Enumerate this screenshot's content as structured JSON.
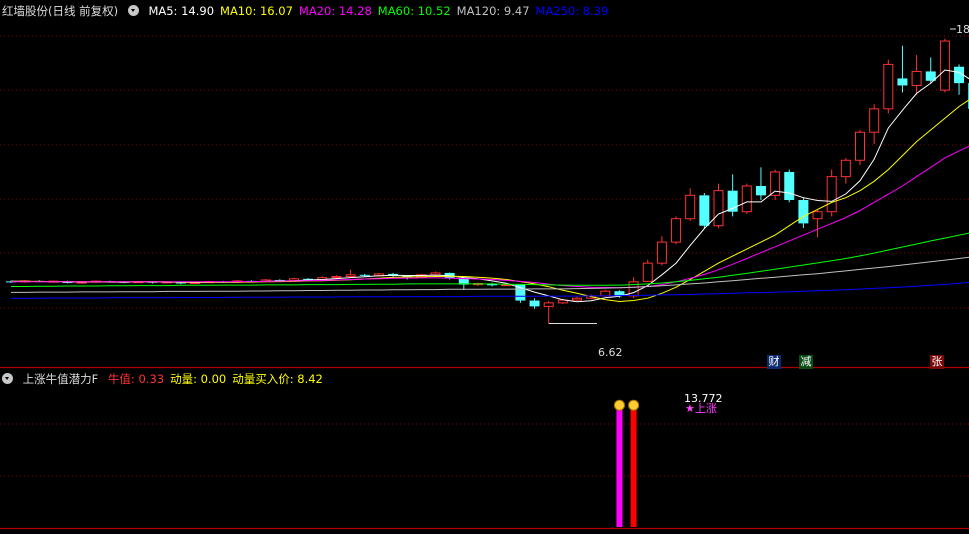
{
  "header": {
    "stock": "红墙股份(日线 前复权)",
    "ma": [
      {
        "label": "MA5: 14.90",
        "color": "#ffffff"
      },
      {
        "label": "MA10: 16.07",
        "color": "#ffff00"
      },
      {
        "label": "MA20: 14.28",
        "color": "#ff00ff"
      },
      {
        "label": "MA60: 10.52",
        "color": "#00ff00"
      },
      {
        "label": "MA120: 9.47",
        "color": "#c0c0c0"
      },
      {
        "label": "MA250: 8.39",
        "color": "#0000ff"
      }
    ]
  },
  "indicator": {
    "name": "上涨牛值潜力F",
    "items": [
      {
        "label": "牛值: 0.33",
        "color": "#ff3333"
      },
      {
        "label": "动量: 0.00",
        "color": "#ffff00"
      },
      {
        "label": "动量买入价: 8.42",
        "color": "#ffff00"
      }
    ]
  },
  "colors": {
    "up": "#ff3232",
    "down": "#54ffff",
    "grid": "#8b0000"
  },
  "annotations": {
    "low_price": "6.62",
    "high_price": "18.",
    "signal_value": "13.772",
    "signal_text": "★上涨",
    "tag_cai": "财",
    "tag_jian": "减",
    "tag_zhang": "张"
  },
  "chart_data": [
    {
      "type": "candlestick",
      "title": "红墙股份(日线 前复权)",
      "ylim": [
        4.8,
        19.6
      ],
      "candles": [
        [
          8.42,
          8.38,
          8.45,
          8.35
        ],
        [
          8.4,
          8.44,
          8.48,
          8.36
        ],
        [
          8.44,
          8.41,
          8.47,
          8.38
        ],
        [
          8.41,
          8.43,
          8.46,
          8.37
        ],
        [
          8.43,
          8.35,
          8.45,
          8.33
        ],
        [
          8.35,
          8.39,
          8.42,
          8.33
        ],
        [
          8.39,
          8.43,
          8.46,
          8.36
        ],
        [
          8.43,
          8.4,
          8.45,
          8.37
        ],
        [
          8.4,
          8.37,
          8.43,
          8.34
        ],
        [
          8.37,
          8.41,
          8.44,
          8.35
        ],
        [
          8.41,
          8.36,
          8.43,
          8.33
        ],
        [
          8.36,
          8.4,
          8.42,
          8.34
        ],
        [
          8.4,
          8.33,
          8.42,
          8.3
        ],
        [
          8.33,
          8.37,
          8.4,
          8.31
        ],
        [
          8.37,
          8.41,
          8.44,
          8.35
        ],
        [
          8.41,
          8.38,
          8.44,
          8.36
        ],
        [
          8.38,
          8.44,
          8.48,
          8.36
        ],
        [
          8.44,
          8.41,
          8.47,
          8.39
        ],
        [
          8.41,
          8.48,
          8.52,
          8.4
        ],
        [
          8.48,
          8.45,
          8.51,
          8.43
        ],
        [
          8.45,
          8.53,
          8.58,
          8.44
        ],
        [
          8.53,
          8.5,
          8.56,
          8.47
        ],
        [
          8.5,
          8.58,
          8.64,
          8.48
        ],
        [
          8.58,
          8.63,
          8.68,
          8.55
        ],
        [
          8.63,
          8.7,
          8.92,
          8.6
        ],
        [
          8.7,
          8.66,
          8.74,
          8.62
        ],
        [
          8.66,
          8.74,
          8.78,
          8.64
        ],
        [
          8.74,
          8.65,
          8.78,
          8.61
        ],
        [
          8.65,
          8.6,
          8.68,
          8.5
        ],
        [
          8.6,
          8.7,
          8.74,
          8.58
        ],
        [
          8.7,
          8.78,
          8.84,
          8.66
        ],
        [
          8.78,
          8.55,
          8.8,
          8.5
        ],
        [
          8.55,
          8.28,
          8.58,
          8.05
        ],
        [
          8.28,
          8.33,
          8.37,
          8.22
        ],
        [
          8.33,
          8.25,
          8.36,
          8.2
        ],
        [
          8.25,
          8.28,
          8.31,
          8.22
        ],
        [
          8.28,
          7.6,
          8.3,
          7.5
        ],
        [
          7.6,
          7.35,
          7.7,
          7.25
        ],
        [
          7.35,
          7.5,
          7.58,
          6.62
        ],
        [
          7.5,
          7.62,
          7.68,
          7.45
        ],
        [
          7.62,
          7.7,
          7.76,
          7.58
        ],
        [
          7.7,
          7.8,
          7.86,
          7.66
        ],
        [
          7.8,
          8.0,
          8.06,
          7.76
        ],
        [
          8.0,
          7.8,
          8.04,
          7.72
        ],
        [
          7.8,
          8.4,
          8.6,
          7.7
        ],
        [
          8.42,
          9.2,
          9.35,
          8.4
        ],
        [
          9.2,
          10.1,
          10.35,
          9.1
        ],
        [
          10.1,
          11.1,
          11.2,
          10.0
        ],
        [
          11.1,
          12.1,
          12.4,
          11.0
        ],
        [
          12.1,
          10.8,
          12.2,
          10.7
        ],
        [
          10.8,
          12.3,
          12.6,
          10.7
        ],
        [
          12.3,
          11.4,
          13.0,
          11.2
        ],
        [
          11.4,
          12.5,
          12.6,
          11.3
        ],
        [
          12.5,
          12.1,
          13.3,
          11.9
        ],
        [
          12.1,
          13.1,
          13.2,
          11.9
        ],
        [
          13.1,
          11.9,
          13.2,
          11.8
        ],
        [
          11.9,
          10.9,
          12.0,
          10.7
        ],
        [
          11.1,
          11.4,
          11.5,
          10.3
        ],
        [
          11.4,
          12.9,
          13.2,
          11.2
        ],
        [
          12.9,
          13.6,
          13.7,
          12.6
        ],
        [
          13.6,
          14.8,
          14.9,
          13.4
        ],
        [
          14.8,
          15.8,
          16.0,
          14.3
        ],
        [
          15.8,
          17.7,
          17.9,
          15.6
        ],
        [
          17.1,
          16.8,
          18.5,
          16.5
        ],
        [
          16.8,
          17.4,
          18.1,
          16.4
        ],
        [
          17.4,
          17.0,
          18.0,
          16.9
        ],
        [
          16.6,
          18.7,
          18.8,
          16.5
        ],
        [
          17.6,
          16.9,
          17.7,
          16.4
        ],
        [
          16.9,
          15.8,
          17.0,
          15.6
        ]
      ],
      "ma_series": [
        {
          "name": "MA5",
          "values": [
            8.43,
            8.42,
            8.41,
            8.41,
            8.4,
            8.39,
            8.4,
            8.39,
            8.39,
            8.4,
            8.4,
            8.39,
            8.38,
            8.37,
            8.38,
            8.38,
            8.39,
            8.4,
            8.42,
            8.44,
            8.45,
            8.48,
            8.5,
            8.54,
            8.58,
            8.62,
            8.66,
            8.68,
            8.67,
            8.67,
            8.69,
            8.66,
            8.58,
            8.53,
            8.44,
            8.34,
            8.15,
            7.96,
            7.8,
            7.63,
            7.55,
            7.59,
            7.72,
            7.78,
            7.94,
            8.24,
            8.7,
            9.2,
            9.96,
            10.68,
            11.3,
            11.54,
            11.82,
            11.82,
            12.28,
            12.2,
            12.0,
            11.88,
            11.84,
            12.16,
            12.72,
            13.64,
            14.98,
            15.74,
            16.46,
            16.9,
            17.46,
            17.36,
            16.98
          ]
        },
        {
          "name": "MA10",
          "values": [
            8.42,
            8.42,
            8.42,
            8.41,
            8.41,
            8.41,
            8.4,
            8.4,
            8.4,
            8.4,
            8.4,
            8.4,
            8.39,
            8.39,
            8.39,
            8.39,
            8.39,
            8.39,
            8.4,
            8.41,
            8.42,
            8.44,
            8.45,
            8.47,
            8.49,
            8.52,
            8.55,
            8.59,
            8.61,
            8.62,
            8.63,
            8.64,
            8.63,
            8.6,
            8.56,
            8.5,
            8.41,
            8.31,
            8.19,
            8.04,
            7.91,
            7.77,
            7.64,
            7.56,
            7.6,
            7.7,
            7.91,
            8.17,
            8.5,
            8.85,
            9.2,
            9.5,
            9.8,
            10.1,
            10.4,
            10.8,
            11.2,
            11.5,
            11.8,
            12.0,
            12.3,
            12.7,
            13.2,
            13.8,
            14.4,
            14.9,
            15.4,
            15.9,
            16.3
          ]
        },
        {
          "name": "MA20",
          "values": [
            8.4,
            8.4,
            8.4,
            8.4,
            8.4,
            8.4,
            8.4,
            8.4,
            8.4,
            8.4,
            8.4,
            8.4,
            8.4,
            8.4,
            8.4,
            8.4,
            8.41,
            8.41,
            8.42,
            8.43,
            8.44,
            8.45,
            8.46,
            8.48,
            8.5,
            8.52,
            8.53,
            8.55,
            8.56,
            8.57,
            8.57,
            8.56,
            8.54,
            8.52,
            8.5,
            8.46,
            8.42,
            8.37,
            8.3,
            8.24,
            8.2,
            8.17,
            8.16,
            8.15,
            8.16,
            8.2,
            8.28,
            8.4,
            8.55,
            8.72,
            8.92,
            9.15,
            9.4,
            9.65,
            9.9,
            10.15,
            10.4,
            10.65,
            10.9,
            11.15,
            11.45,
            11.8,
            12.15,
            12.5,
            12.9,
            13.3,
            13.7,
            14.0,
            14.28
          ]
        },
        {
          "name": "MA60",
          "values": [
            8.2,
            8.2,
            8.21,
            8.21,
            8.22,
            8.22,
            8.22,
            8.23,
            8.23,
            8.24,
            8.24,
            8.24,
            8.25,
            8.25,
            8.25,
            8.26,
            8.26,
            8.26,
            8.27,
            8.27,
            8.27,
            8.28,
            8.28,
            8.28,
            8.29,
            8.29,
            8.3,
            8.3,
            8.31,
            8.31,
            8.31,
            8.31,
            8.31,
            8.31,
            8.31,
            8.3,
            8.29,
            8.28,
            8.27,
            8.26,
            8.25,
            8.25,
            8.25,
            8.26,
            8.28,
            8.31,
            8.35,
            8.4,
            8.46,
            8.53,
            8.6,
            8.68,
            8.76,
            8.85,
            8.94,
            9.03,
            9.12,
            9.21,
            9.3,
            9.4,
            9.51,
            9.63,
            9.76,
            9.89,
            10.02,
            10.15,
            10.27,
            10.4,
            10.52
          ]
        },
        {
          "name": "MA120",
          "values": [
            7.95,
            7.95,
            7.96,
            7.96,
            7.96,
            7.97,
            7.97,
            7.97,
            7.98,
            7.98,
            7.98,
            7.99,
            7.99,
            7.99,
            8.0,
            8.0,
            8.0,
            8.01,
            8.01,
            8.02,
            8.02,
            8.03,
            8.03,
            8.04,
            8.04,
            8.05,
            8.05,
            8.06,
            8.06,
            8.07,
            8.07,
            8.08,
            8.08,
            8.08,
            8.09,
            8.09,
            8.09,
            8.1,
            8.1,
            8.1,
            8.11,
            8.12,
            8.13,
            8.15,
            8.17,
            8.2,
            8.23,
            8.27,
            8.31,
            8.35,
            8.4,
            8.45,
            8.5,
            8.55,
            8.6,
            8.65,
            8.7,
            8.75,
            8.81,
            8.87,
            8.93,
            8.99,
            9.05,
            9.12,
            9.19,
            9.26,
            9.33,
            9.4,
            9.47
          ]
        },
        {
          "name": "MA250",
          "values": [
            7.7,
            7.7,
            7.7,
            7.71,
            7.71,
            7.71,
            7.71,
            7.72,
            7.72,
            7.72,
            7.72,
            7.72,
            7.73,
            7.73,
            7.73,
            7.73,
            7.74,
            7.74,
            7.74,
            7.74,
            7.75,
            7.75,
            7.75,
            7.75,
            7.76,
            7.76,
            7.76,
            7.76,
            7.77,
            7.77,
            7.77,
            7.77,
            7.77,
            7.78,
            7.78,
            7.78,
            7.78,
            7.78,
            7.79,
            7.79,
            7.79,
            7.8,
            7.8,
            7.81,
            7.82,
            7.83,
            7.84,
            7.85,
            7.86,
            7.88,
            7.89,
            7.91,
            7.93,
            7.94,
            7.96,
            7.98,
            8.0,
            8.02,
            8.04,
            8.06,
            8.09,
            8.12,
            8.15,
            8.18,
            8.21,
            8.25,
            8.29,
            8.34,
            8.39
          ]
        }
      ]
    },
    {
      "type": "bar",
      "title": "上涨牛值潜力F",
      "ylim": [
        0,
        1
      ],
      "bars": [
        {
          "index": 43,
          "value": 0.76,
          "color": "#ff00ff"
        },
        {
          "index": 44,
          "value": 0.76,
          "color": "#ff0000"
        }
      ]
    }
  ]
}
